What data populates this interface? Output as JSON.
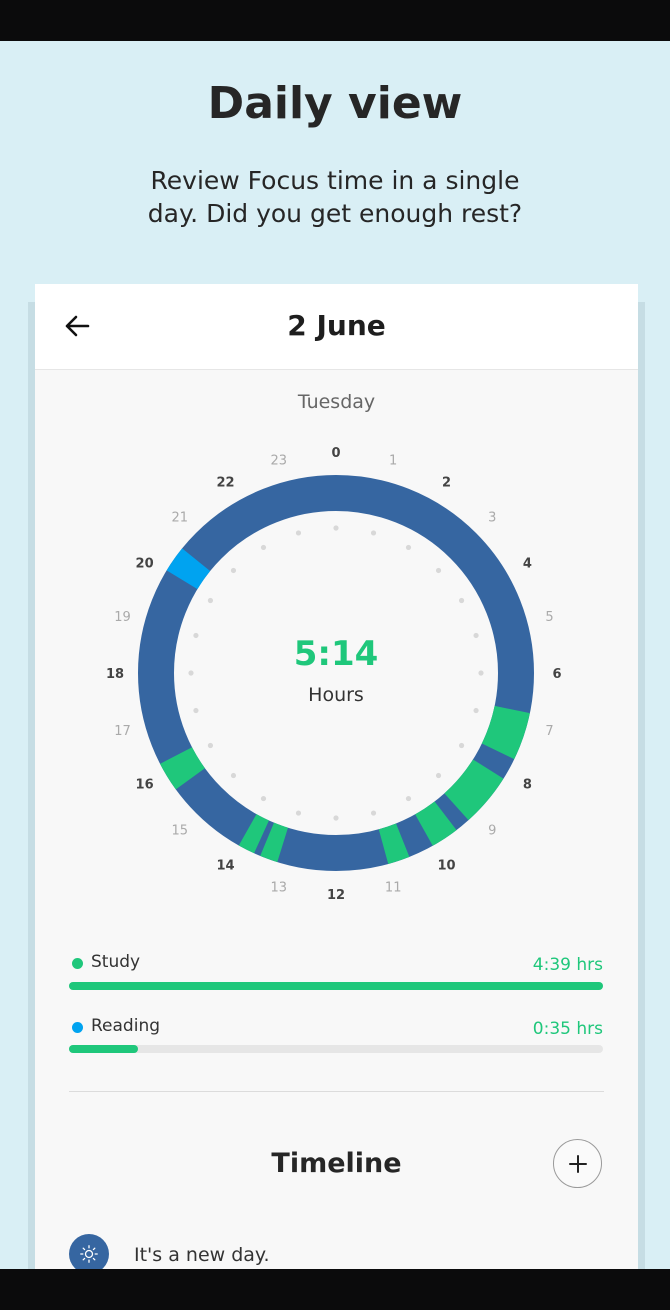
{
  "promo": {
    "title": "Daily view",
    "subtitle": "Review Focus time in a single day. Did you get enough rest?"
  },
  "header": {
    "back_icon": "arrow-left-icon",
    "date": "2 June"
  },
  "weekday": "Tuesday",
  "clock": {
    "hour_labels": [
      "0",
      "1",
      "2",
      "3",
      "4",
      "5",
      "6",
      "7",
      "8",
      "9",
      "10",
      "11",
      "12",
      "13",
      "14",
      "15",
      "16",
      "17",
      "18",
      "19",
      "20",
      "21",
      "22",
      "23"
    ],
    "bold_hours": [
      0,
      2,
      4,
      6,
      8,
      10,
      12,
      14,
      16,
      18,
      20,
      22
    ],
    "total_value": "5:14",
    "total_unit": "Hours",
    "colors": {
      "idle": "#3666a1",
      "study": "#1fc77b",
      "reading": "#00a3f0"
    },
    "sessions_hours": [
      {
        "tag": "study",
        "start": 6.78,
        "end": 7.72
      },
      {
        "tag": "study",
        "start": 8.15,
        "end": 9.2
      },
      {
        "tag": "study",
        "start": 9.5,
        "end": 10.05
      },
      {
        "tag": "study",
        "start": 10.55,
        "end": 10.98
      },
      {
        "tag": "study",
        "start": 13.15,
        "end": 13.5
      },
      {
        "tag": "study",
        "start": 13.63,
        "end": 13.96
      },
      {
        "tag": "study",
        "start": 15.6,
        "end": 16.18
      },
      {
        "tag": "reading",
        "start": 20.08,
        "end": 20.6
      }
    ]
  },
  "tags": [
    {
      "name": "Study",
      "time": "4:39 hrs",
      "color": "#1fc77b",
      "fraction": 1.0
    },
    {
      "name": "Reading",
      "time": "0:35 hrs",
      "color": "#00a3f0",
      "fraction": 0.13
    }
  ],
  "timeline": {
    "title": "Timeline",
    "add_icon": "plus-icon",
    "first_entry_icon": "sun-icon",
    "first_entry": "It's a new day."
  }
}
